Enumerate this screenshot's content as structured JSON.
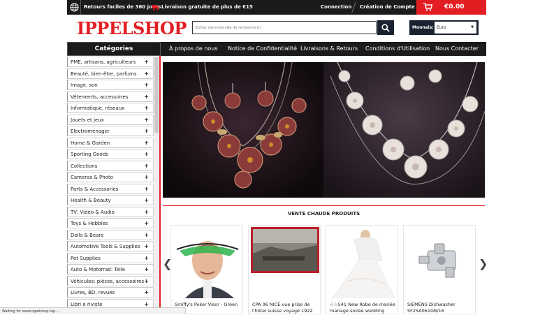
{
  "topbar": {
    "returns": "Retours faciles de 360 jours",
    "shipping": "Livraison gratuite de plus de €15",
    "connection": "Connection",
    "create_account": "Création de Compte",
    "cart_total": "€0.00"
  },
  "logo": "IPPELSHOP",
  "search": {
    "placeholder": "Entrez vos mots clés de recherche ici"
  },
  "currency": {
    "label": "Monnais:",
    "selected": "Euro"
  },
  "nav": {
    "categories": "Catégories",
    "items": [
      "À propos de nous",
      "Notice de Confidentialité",
      "Livraisons & Retours",
      "Conditions d'Utilisation",
      "Nous Contacter"
    ]
  },
  "sidebar": {
    "items": [
      "PME, artisans, agriculteurs",
      "Beauté, bien-être, parfums",
      "Image, son",
      "Vêtements, accessoires",
      "Informatique, réseaux",
      "Jouets et jeux",
      "Electroménager",
      "Home & Garden",
      "Sporting Goods",
      "Collections",
      "Cameras & Photo",
      "Parts & Accessories",
      "Health & Beauty",
      "TV, Video & Audio",
      "Toys & Hobbies",
      "Dolls & Bears",
      "Automotive Tools & Supplies",
      "Pet Supplies",
      "Auto & Motorrad: Teile",
      "Véhicules: pièces, accessoires",
      "Livres, BD, revues",
      "Libri e riviste"
    ],
    "plus": "+"
  },
  "hot_products": {
    "title": "VENTE CHAUDE PRODUITS",
    "items": [
      {
        "name": "Smiffy's Poker Visor - Green"
      },
      {
        "name": "CPA 06 NICE vue prise de l'hôtel suisse voyagé 1922"
      },
      {
        "name": "☆☆541 New Robe de mariée mariage soirée wedding"
      },
      {
        "name": "SIEMENS Dishwasher SF25A061GB/16"
      }
    ],
    "prev": "❮",
    "next": "❯"
  },
  "status_bar": "Waiting for www.ippelshop.top...",
  "colors": {
    "accent": "#e21e23",
    "dark": "#1b1b1b",
    "navy": "#1a2230"
  }
}
